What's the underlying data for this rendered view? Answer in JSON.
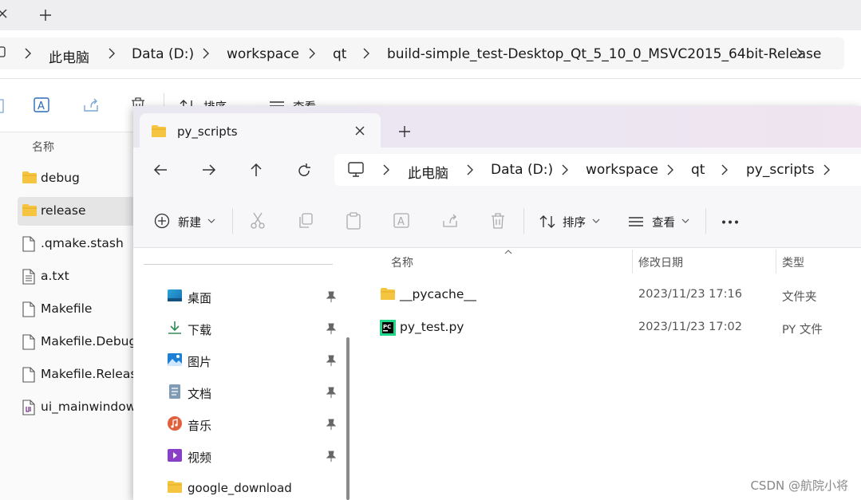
{
  "back": {
    "breadcrumbs": [
      "此电脑",
      "Data (D:)",
      "workspace",
      "qt",
      "build-simple_test-Desktop_Qt_5_10_0_MSVC2015_64bit-Release"
    ],
    "toolbar": {
      "sort_label": "排序",
      "view_label": "查看"
    },
    "column_name": "名称",
    "items": [
      {
        "name": "debug",
        "icon": "folder-icon"
      },
      {
        "name": "release",
        "icon": "folder-icon"
      },
      {
        "name": ".qmake.stash",
        "icon": "file-icon"
      },
      {
        "name": "a.txt",
        "icon": "text-file-icon"
      },
      {
        "name": "Makefile",
        "icon": "file-icon"
      },
      {
        "name": "Makefile.Debug",
        "icon": "file-icon"
      },
      {
        "name": "Makefile.Release",
        "icon": "file-icon"
      },
      {
        "name": "ui_mainwindow.",
        "icon": "ui-file-icon"
      }
    ]
  },
  "front": {
    "tab_title": "py_scripts",
    "breadcrumbs": [
      "此电脑",
      "Data (D:)",
      "workspace",
      "qt",
      "py_scripts"
    ],
    "toolbar": {
      "new_label": "新建",
      "sort_label": "排序",
      "view_label": "查看"
    },
    "nav_items": [
      {
        "label": "桌面",
        "icon": "desktop-icon",
        "pinned": true
      },
      {
        "label": "下载",
        "icon": "download-icon",
        "pinned": true
      },
      {
        "label": "图片",
        "icon": "pictures-icon",
        "pinned": true
      },
      {
        "label": "文档",
        "icon": "documents-icon",
        "pinned": true
      },
      {
        "label": "音乐",
        "icon": "music-icon",
        "pinned": true
      },
      {
        "label": "视频",
        "icon": "videos-icon",
        "pinned": true
      },
      {
        "label": "google_download",
        "icon": "folder-icon",
        "pinned": false
      }
    ],
    "columns": {
      "name": "名称",
      "modified": "修改日期",
      "type": "类型"
    },
    "files": [
      {
        "name": "__pycache__",
        "modified": "2023/11/23 17:16",
        "type": "文件夹",
        "icon": "folder-icon"
      },
      {
        "name": "py_test.py",
        "modified": "2023/11/23 17:02",
        "type": "PY 文件",
        "icon": "pycharm-file-icon"
      }
    ]
  },
  "watermark": "CSDN @航院小将",
  "colors": {
    "folder": "#f5c542",
    "selected_row": "#e5e5e5",
    "accent": "#0067c0"
  }
}
